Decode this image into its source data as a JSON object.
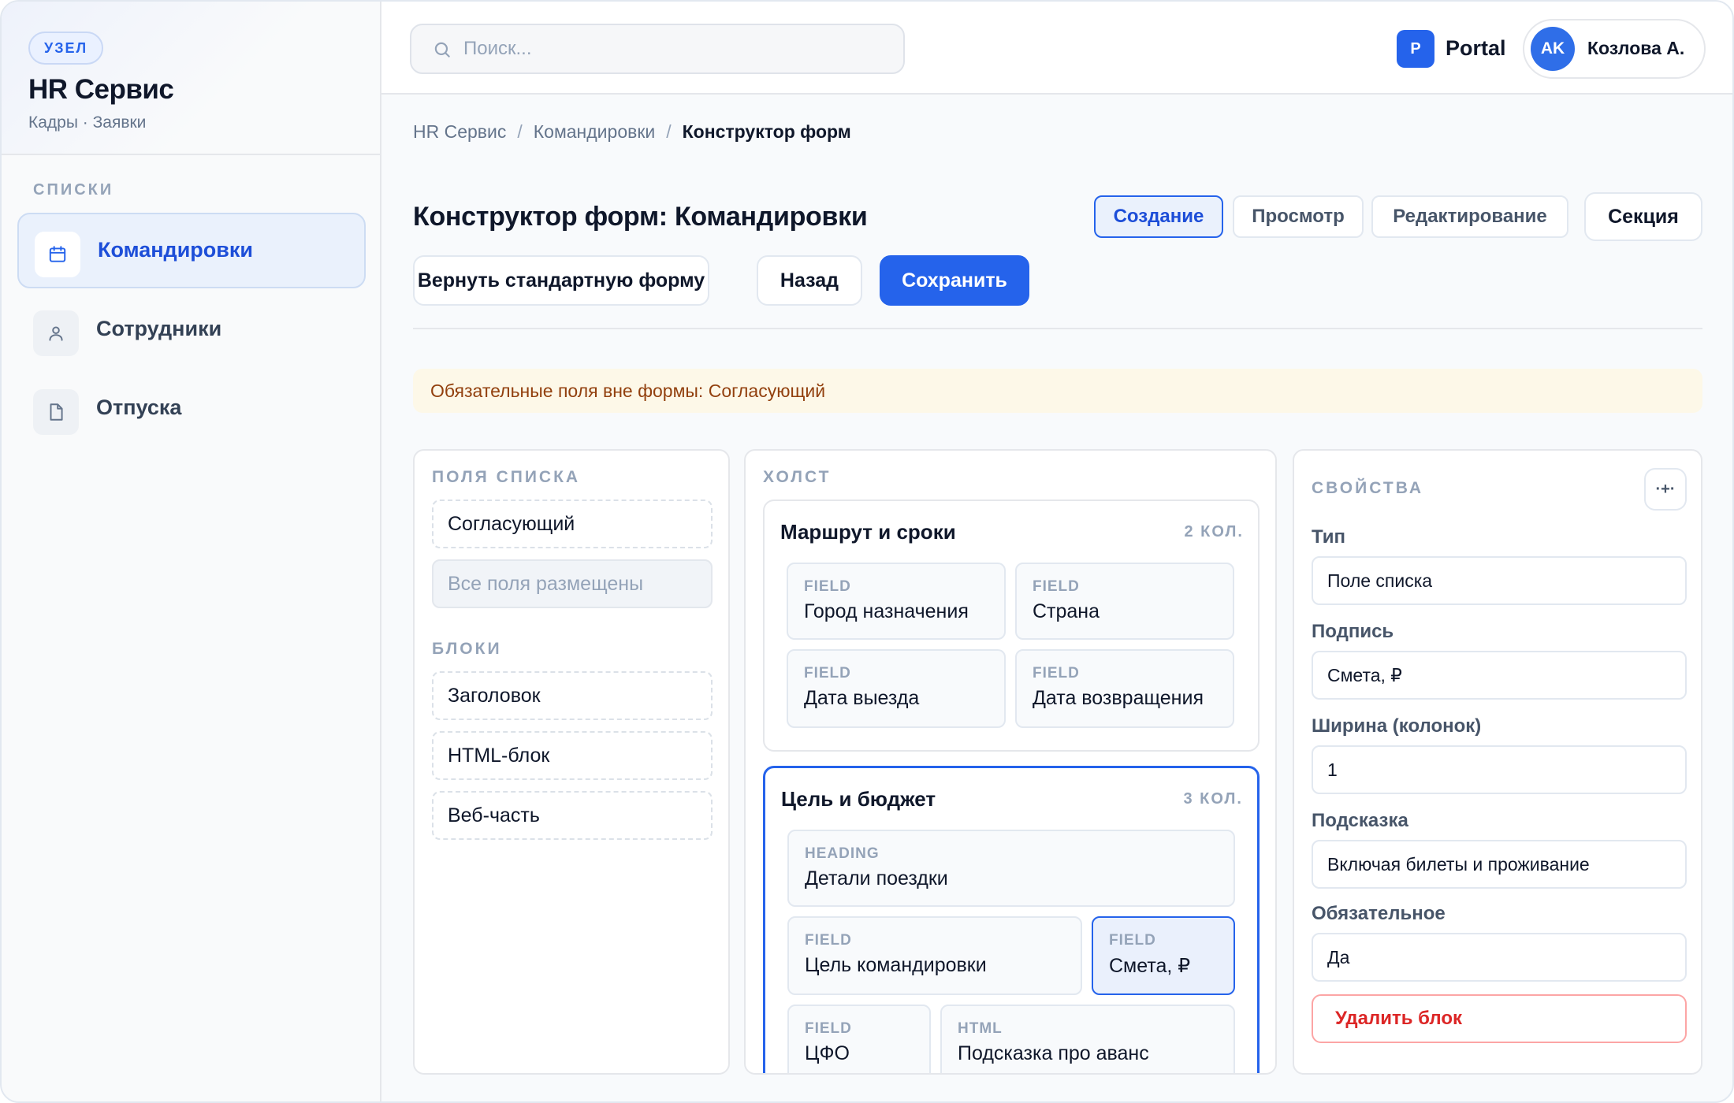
{
  "site": {
    "badge": "УЗЕЛ",
    "title": "HR Сервис",
    "subtitle": "Кадры · Заявки"
  },
  "sidebar": {
    "section_label": "СПИСКИ",
    "items": [
      {
        "label": "Командировки",
        "icon": "calendar-icon",
        "active": true
      },
      {
        "label": "Сотрудники",
        "icon": "user-icon",
        "active": false
      },
      {
        "label": "Отпуска",
        "icon": "document-icon",
        "active": false
      }
    ]
  },
  "topbar": {
    "search_placeholder": "Поиск...",
    "portal_logo": "P",
    "portal_name": "Portal",
    "user_initials": "AK",
    "user_name": "Козлова А."
  },
  "breadcrumb": [
    "HR Сервис",
    "Командировки",
    "Конструктор форм"
  ],
  "breadcrumb_sep": "/",
  "page": {
    "title": "Конструктор форм: Командировки",
    "modes": [
      "Создание",
      "Просмотр",
      "Редактирование"
    ],
    "active_mode": "Создание",
    "section_button": "Секция",
    "actions": {
      "reset": "Вернуть стандартную форму",
      "back": "Назад",
      "save": "Сохранить"
    },
    "warning": "Обязательные поля вне формы: Согласующий"
  },
  "palette": {
    "fields_heading": "ПОЛЯ СПИСКА",
    "fields": [
      "Согласующий"
    ],
    "empty_note": "Все поля размещены",
    "blocks_heading": "БЛОКИ",
    "blocks": [
      "Заголовок",
      "HTML-блок",
      "Веб-часть"
    ]
  },
  "canvas": {
    "heading": "ХОЛСТ",
    "sections": [
      {
        "title": "Маршрут и сроки",
        "cols": "2 КОЛ.",
        "cells": [
          {
            "kind": "FIELD",
            "label": "Город назначения"
          },
          {
            "kind": "FIELD",
            "label": "Страна"
          },
          {
            "kind": "FIELD",
            "label": "Дата выезда"
          },
          {
            "kind": "FIELD",
            "label": "Дата возвращения"
          }
        ]
      },
      {
        "title": "Цель и бюджет",
        "cols": "3 КОЛ.",
        "cells": [
          {
            "kind": "HEADING",
            "label": "Детали поездки"
          },
          {
            "kind": "FIELD",
            "label": "Цель командировки"
          },
          {
            "kind": "FIELD",
            "label": "Смета, ₽",
            "selected": true
          },
          {
            "kind": "FIELD",
            "label": "ЦФО"
          },
          {
            "kind": "HTML",
            "label": "Подсказка про аванс"
          }
        ]
      }
    ]
  },
  "properties": {
    "heading": "СВОЙСТВА",
    "tool_glyph": "·+·",
    "rows": [
      {
        "label": "Тип",
        "value": "Поле списка"
      },
      {
        "label": "Подпись",
        "value": "Смета, ₽"
      },
      {
        "label": "Ширина (колонок)",
        "value": "1"
      },
      {
        "label": "Подсказка",
        "value": "Включая билеты и проживание"
      },
      {
        "label": "Обязательное",
        "value": "Да"
      }
    ],
    "delete_label": "Удалить блок"
  },
  "colors": {
    "accent": "#2563eb",
    "warning_bg": "#fdf8e8",
    "warning_text": "#92400e",
    "danger": "#dc2626"
  }
}
